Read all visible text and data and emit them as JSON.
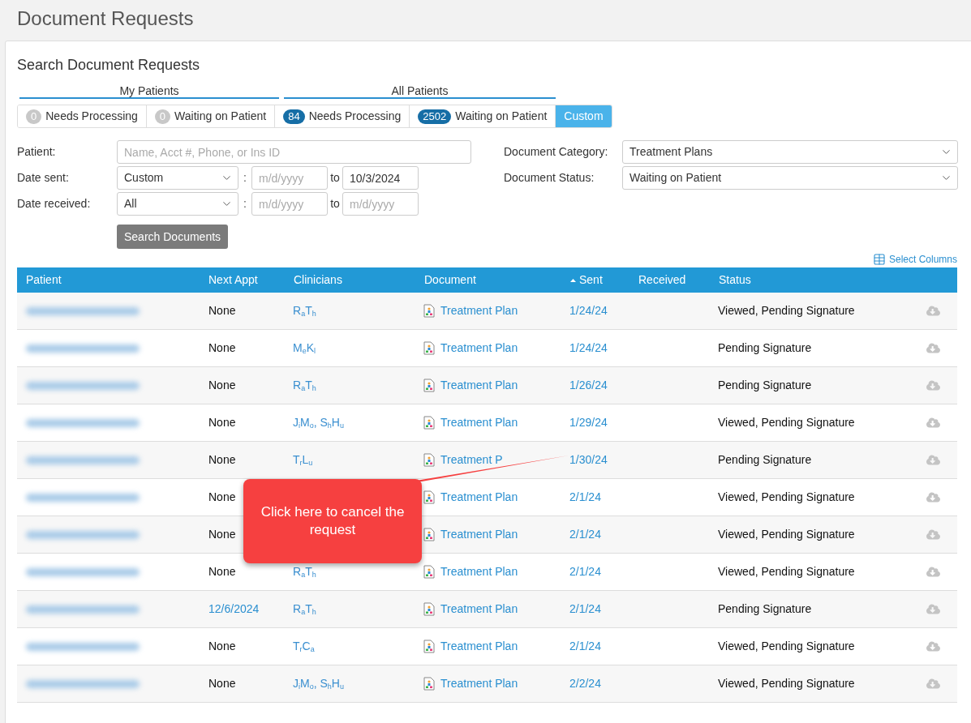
{
  "page_title": "Document Requests",
  "panel_title": "Search Document Requests",
  "tab_groups": [
    {
      "label": "My Patients"
    },
    {
      "label": "All Patients"
    }
  ],
  "tabs": [
    {
      "badge": "0",
      "badge_highlighted": false,
      "label": "Needs Processing",
      "selected": false
    },
    {
      "badge": "0",
      "badge_highlighted": false,
      "label": "Waiting on Patient",
      "selected": false
    },
    {
      "badge": "84",
      "badge_highlighted": true,
      "label": "Needs Processing",
      "selected": false
    },
    {
      "badge": "2502",
      "badge_highlighted": true,
      "label": "Waiting on Patient",
      "selected": false
    },
    {
      "label": "Custom",
      "selected": true
    }
  ],
  "form": {
    "patient": {
      "label": "Patient:",
      "placeholder": "Name, Acct #, Phone, or Ins ID"
    },
    "date_sent": {
      "label": "Date sent:",
      "select": "Custom",
      "separator": ":",
      "from_placeholder": "m/d/yyyy",
      "to_label": "to",
      "to_value": "10/3/2024"
    },
    "date_received": {
      "label": "Date received:",
      "select": "All",
      "separator": ":",
      "from_placeholder": "m/d/yyyy",
      "to_label": "to",
      "to_placeholder": "m/d/yyyy"
    },
    "document_category": {
      "label": "Document Category:",
      "value": "Treatment Plans"
    },
    "document_status": {
      "label": "Document Status:",
      "value": "Waiting on Patient"
    },
    "search_button": "Search Documents"
  },
  "select_columns": "Select Columns",
  "table": {
    "columns": [
      {
        "label": "Patient",
        "sorted": false
      },
      {
        "label": "Next Appt",
        "sorted": false
      },
      {
        "label": "Clinicians",
        "sorted": false
      },
      {
        "label": "Document",
        "sorted": false
      },
      {
        "label": "Sent",
        "sorted": true
      },
      {
        "label": "Received",
        "sorted": false
      },
      {
        "label": "Status",
        "sorted": false
      }
    ],
    "rows": [
      {
        "next_appt": {
          "text": "None",
          "kind": "plain"
        },
        "clinicians": "R$_{a}$T$_{h}$",
        "document": "Treatment Plan",
        "sent": "1/24/24",
        "status": "Viewed, Pending Signature"
      },
      {
        "next_appt": {
          "text": "None",
          "kind": "plain"
        },
        "clinicians": "M$_{e}$K$_{l}$",
        "document": "Treatment Plan",
        "sent": "1/24/24",
        "status": "Pending Signature"
      },
      {
        "next_appt": {
          "text": "None",
          "kind": "plain"
        },
        "clinicians": "R$_{a}$T$_{h}$",
        "document": "Treatment Plan",
        "sent": "1/26/24",
        "status": "Pending Signature"
      },
      {
        "next_appt": {
          "text": "None",
          "kind": "plain"
        },
        "clinicians": "J$_{i}$M$_{o}$, S$_{h}$H$_{u}$",
        "document": "Treatment Plan",
        "sent": "1/29/24",
        "status": "Viewed, Pending Signature"
      },
      {
        "next_appt": {
          "text": "None",
          "kind": "plain"
        },
        "clinicians": "T$_{r}$L$_{u}$",
        "document": "Treatment P",
        "sent": "1/30/24",
        "status": "Pending Signature"
      },
      {
        "next_appt": {
          "text": "None",
          "kind": "plain"
        },
        "document": "Treatment Plan",
        "sent": "2/1/24",
        "status": "Viewed, Pending Signature"
      },
      {
        "next_appt": {
          "text": "None",
          "kind": "plain"
        },
        "document": "Treatment Plan",
        "sent": "2/1/24",
        "status": "Viewed, Pending Signature"
      },
      {
        "next_appt": {
          "text": "None",
          "kind": "plain"
        },
        "clinicians": "R$_{a}$T$_{h}$",
        "document": "Treatment Plan",
        "sent": "2/1/24",
        "status": "Viewed, Pending Signature"
      },
      {
        "next_appt": {
          "text": "12/6/2024",
          "kind": "link"
        },
        "clinicians": "R$_{a}$T$_{h}$",
        "document": "Treatment Plan",
        "sent": "2/1/24",
        "status": "Pending Signature"
      },
      {
        "next_appt": {
          "text": "None",
          "kind": "plain"
        },
        "clinicians": "T$_{r}$C$_{a}$",
        "document": "Treatment Plan",
        "sent": "2/1/24",
        "status": "Viewed, Pending Signature"
      },
      {
        "next_appt": {
          "text": "None",
          "kind": "plain"
        },
        "clinicians": "J$_{i}$M$_{o}$, S$_{h}$H$_{u}$",
        "document": "Treatment Plan",
        "sent": "2/2/24",
        "status": "Viewed, Pending Signature"
      }
    ]
  },
  "callout": {
    "text": "Click here to cancel the request"
  }
}
